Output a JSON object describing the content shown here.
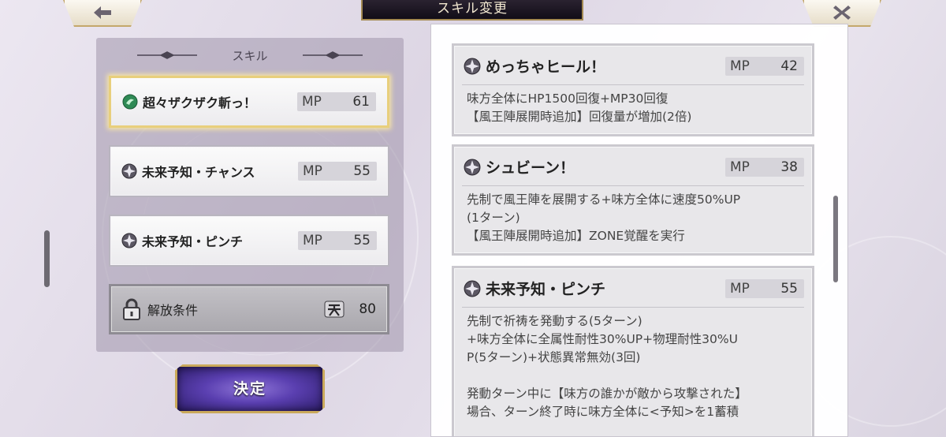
{
  "header": {
    "title": "スキル変更"
  },
  "nav": {
    "back_icon": "back-arrow-icon",
    "close_icon": "close-icon"
  },
  "left_panel": {
    "title": "スキル",
    "slots": [
      {
        "name": "超々ザクザク斬っ！",
        "mp_label": "MP",
        "mp": "61",
        "icon": "green-skill-icon",
        "selected": true
      },
      {
        "name": "未来予知・チャンス",
        "mp_label": "MP",
        "mp": "55",
        "icon": "star-skill-icon",
        "selected": false
      },
      {
        "name": "未来予知・ピンチ",
        "mp_label": "MP",
        "mp": "55",
        "icon": "star-skill-icon",
        "selected": false
      }
    ],
    "unlock": {
      "label": "解放条件",
      "icon": "ten-kanji-icon",
      "value": "80"
    }
  },
  "decide_button": {
    "label": "決定"
  },
  "details": [
    {
      "name": "めっちゃヒール！",
      "mp_label": "MP",
      "mp": "42",
      "lines": [
        "味方全体にHP1500回復+MP30回復",
        "【風王陣展開時追加】回復量が増加(2倍)"
      ]
    },
    {
      "name": "シュビーン！",
      "mp_label": "MP",
      "mp": "38",
      "lines": [
        "先制で風王陣を展開する+味方全体に速度50%UP",
        "(1ターン)",
        "【風王陣展開時追加】ZONE覚醒を実行"
      ]
    },
    {
      "name": "未来予知・ピンチ",
      "mp_label": "MP",
      "mp": "55",
      "lines": [
        "先制で祈祷を発動する(5ターン)",
        "+味方全体に全属性耐性30%UP+物理耐性30%U",
        "P(5ターン)+状態異常無効(3回)",
        "",
        "発動ターン中に【味方の誰かが敵から攻撃された】",
        "場合、ターン終了時に味方全体に<予知>を1蓄積"
      ]
    }
  ],
  "colors": {
    "accent_gold": "#c4a86b",
    "decide_purple": "#5a3fb0",
    "panel_lilac": "#a096ac"
  }
}
